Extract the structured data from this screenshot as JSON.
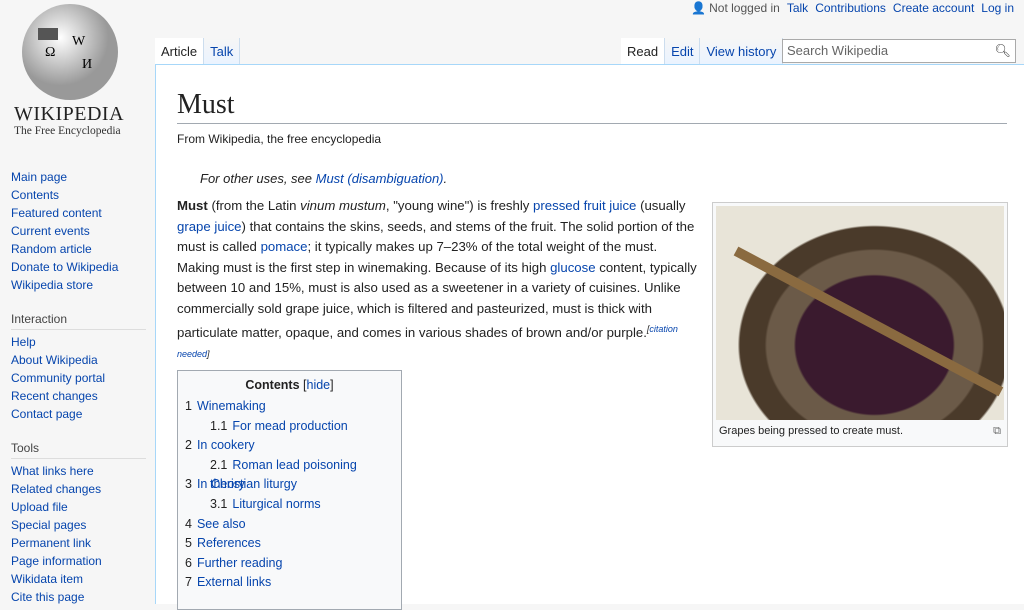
{
  "logo": {
    "wordmark": "Wikipedia",
    "tagline": "The Free Encyclopedia"
  },
  "personal": {
    "status": "Not logged in",
    "links": [
      "Talk",
      "Contributions",
      "Create account",
      "Log in"
    ]
  },
  "tabs_left": [
    "Article",
    "Talk"
  ],
  "tabs_right": [
    "Read",
    "Edit",
    "View history"
  ],
  "search": {
    "placeholder": "Search Wikipedia"
  },
  "sidebar": {
    "nav": [
      "Main page",
      "Contents",
      "Featured content",
      "Current events",
      "Random article",
      "Donate to Wikipedia",
      "Wikipedia store"
    ],
    "interaction_heading": "Interaction",
    "interaction": [
      "Help",
      "About Wikipedia",
      "Community portal",
      "Recent changes",
      "Contact page"
    ],
    "tools_heading": "Tools",
    "tools": [
      "What links here",
      "Related changes",
      "Upload file",
      "Special pages",
      "Permanent link",
      "Page information",
      "Wikidata item",
      "Cite this page"
    ]
  },
  "article": {
    "title": "Must",
    "tagline": "From Wikipedia, the free encyclopedia",
    "hatnote": {
      "prefix": "For other uses, see ",
      "link": "Must (disambiguation)",
      "suffix": "."
    },
    "p": {
      "b": "Must",
      "t1": " (from the Latin ",
      "i": "vinum mustum",
      "t2": ", \"young wine\") is freshly ",
      "l1": "pressed fruit juice",
      "t3": " (usually ",
      "l2": "grape juice",
      "t4": ") that contains the skins, seeds, and stems of the fruit. The solid portion of the must is called ",
      "l3": "pomace",
      "t5": "; it typically makes up 7–23% of the total weight of the must. Making must is the first step in winemaking. Because of its high ",
      "l4": "glucose",
      "t6": " content, typically between 10 and 15%, must is also used as a sweetener in a variety of cuisines. Unlike commercially sold grape juice, which is filtered and pasteurized, must is thick with particulate matter, opaque, and comes in various shades of brown and/or purple.",
      "cite": "citation needed"
    },
    "image_caption": "Grapes being pressed to create must.",
    "toc": {
      "title": "Contents",
      "hide": "hide",
      "items": [
        {
          "n": "1",
          "t": "Winemaking"
        },
        {
          "n": "1.1",
          "t": "For mead production",
          "sub": true
        },
        {
          "n": "2",
          "t": "In cookery"
        },
        {
          "n": "2.1",
          "t": "Roman lead poisoning theory",
          "sub": true
        },
        {
          "n": "3",
          "t": "In Christian liturgy"
        },
        {
          "n": "3.1",
          "t": "Liturgical norms",
          "sub": true
        },
        {
          "n": "4",
          "t": "See also"
        },
        {
          "n": "5",
          "t": "References"
        },
        {
          "n": "6",
          "t": "Further reading"
        },
        {
          "n": "7",
          "t": "External links"
        }
      ]
    }
  }
}
